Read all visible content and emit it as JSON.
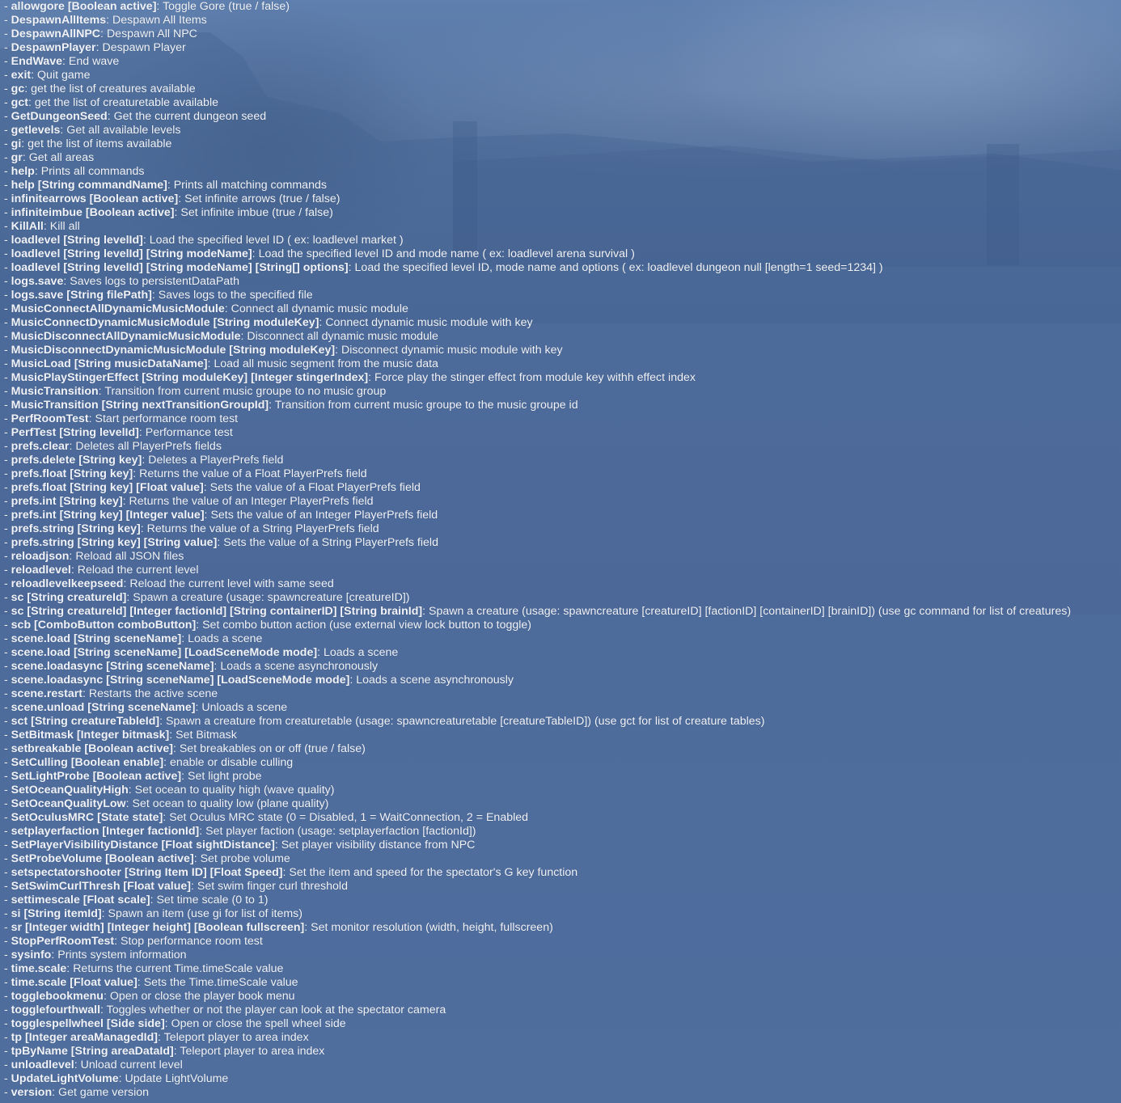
{
  "console": {
    "commands": [
      {
        "name": "allowgore [Boolean active]",
        "desc": "Toggle Gore (true / false)"
      },
      {
        "name": "DespawnAllItems",
        "desc": "Despawn All Items"
      },
      {
        "name": "DespawnAllNPC",
        "desc": "Despawn All NPC"
      },
      {
        "name": "DespawnPlayer",
        "desc": "Despawn Player"
      },
      {
        "name": "EndWave",
        "desc": "End wave"
      },
      {
        "name": "exit",
        "desc": "Quit game"
      },
      {
        "name": "gc",
        "desc": "get the list of creatures available"
      },
      {
        "name": "gct",
        "desc": "get the list of creaturetable available"
      },
      {
        "name": "GetDungeonSeed",
        "desc": "Get the current dungeon seed"
      },
      {
        "name": "getlevels",
        "desc": "Get all available levels"
      },
      {
        "name": "gi",
        "desc": "get the list of items available"
      },
      {
        "name": "gr",
        "desc": "Get all areas"
      },
      {
        "name": "help",
        "desc": "Prints all commands"
      },
      {
        "name": "help [String commandName]",
        "desc": "Prints all matching commands"
      },
      {
        "name": "infinitearrows [Boolean active]",
        "desc": "Set infinite arrows (true / false)"
      },
      {
        "name": "infiniteimbue [Boolean active]",
        "desc": "Set infinite imbue (true / false)"
      },
      {
        "name": "KillAll",
        "desc": "Kill all"
      },
      {
        "name": "loadlevel [String levelId]",
        "desc": "Load the specified level ID ( ex: loadlevel market )"
      },
      {
        "name": "loadlevel [String levelId] [String modeName]",
        "desc": "Load the specified level ID and mode name ( ex: loadlevel arena survival )"
      },
      {
        "name": "loadlevel [String levelId] [String modeName] [String[] options]",
        "desc": "Load the specified level ID, mode name and options ( ex: loadlevel dungeon null [length=1 seed=1234] )"
      },
      {
        "name": "logs.save",
        "desc": "Saves logs to persistentDataPath"
      },
      {
        "name": "logs.save [String filePath]",
        "desc": "Saves logs to the specified file"
      },
      {
        "name": "MusicConnectAllDynamicMusicModule",
        "desc": "Connect all dynamic music module"
      },
      {
        "name": "MusicConnectDynamicMusicModule [String moduleKey]",
        "desc": "Connect dynamic music module with key"
      },
      {
        "name": "MusicDisconnectAllDynamicMusicModule",
        "desc": "Disconnect all dynamic music module"
      },
      {
        "name": "MusicDisconnectDynamicMusicModule [String moduleKey]",
        "desc": "Disconnect dynamic music module with key"
      },
      {
        "name": "MusicLoad [String musicDataName]",
        "desc": "Load all music segment from the music data"
      },
      {
        "name": "MusicPlayStingerEffect [String moduleKey] [Integer stingerIndex]",
        "desc": "Force play the stinger effect from module key withh effect index"
      },
      {
        "name": "MusicTransition",
        "desc": "Transition from current music groupe to no music group"
      },
      {
        "name": "MusicTransition [String nextTransitionGroupId]",
        "desc": "Transition from current music groupe to the music groupe id"
      },
      {
        "name": "PerfRoomTest",
        "desc": "Start performance room test"
      },
      {
        "name": "PerfTest [String levelId]",
        "desc": "Performance test"
      },
      {
        "name": "prefs.clear",
        "desc": "Deletes all PlayerPrefs fields"
      },
      {
        "name": "prefs.delete [String key]",
        "desc": "Deletes a PlayerPrefs field"
      },
      {
        "name": "prefs.float [String key]",
        "desc": "Returns the value of a Float PlayerPrefs field"
      },
      {
        "name": "prefs.float [String key] [Float value]",
        "desc": "Sets the value of a Float PlayerPrefs field"
      },
      {
        "name": "prefs.int [String key]",
        "desc": "Returns the value of an Integer PlayerPrefs field"
      },
      {
        "name": "prefs.int [String key] [Integer value]",
        "desc": "Sets the value of an Integer PlayerPrefs field"
      },
      {
        "name": "prefs.string [String key]",
        "desc": "Returns the value of a String PlayerPrefs field"
      },
      {
        "name": "prefs.string [String key] [String value]",
        "desc": "Sets the value of a String PlayerPrefs field"
      },
      {
        "name": "reloadjson",
        "desc": "Reload all JSON files"
      },
      {
        "name": "reloadlevel",
        "desc": "Reload the current level"
      },
      {
        "name": "reloadlevelkeepseed",
        "desc": "Reload the current level with same seed"
      },
      {
        "name": "sc [String creatureId]",
        "desc": "Spawn a creature (usage: spawncreature [creatureID])"
      },
      {
        "name": "sc [String creatureId] [Integer factionId] [String containerID] [String brainId]",
        "desc": "Spawn a creature (usage: spawncreature [creatureID] [factionID] [containerID] [brainID]) (use gc command for list of creatures)"
      },
      {
        "name": "scb [ComboButton comboButton]",
        "desc": "Set combo button action (use external view lock button to toggle)"
      },
      {
        "name": "scene.load [String sceneName]",
        "desc": "Loads a scene"
      },
      {
        "name": "scene.load [String sceneName] [LoadSceneMode mode]",
        "desc": "Loads a scene"
      },
      {
        "name": "scene.loadasync [String sceneName]",
        "desc": "Loads a scene asynchronously"
      },
      {
        "name": "scene.loadasync [String sceneName] [LoadSceneMode mode]",
        "desc": "Loads a scene asynchronously"
      },
      {
        "name": "scene.restart",
        "desc": "Restarts the active scene"
      },
      {
        "name": "scene.unload [String sceneName]",
        "desc": "Unloads a scene"
      },
      {
        "name": "sct [String creatureTableId]",
        "desc": "Spawn a creature from creaturetable (usage: spawncreaturetable [creatureTableID]) (use gct for list of creature tables)"
      },
      {
        "name": "SetBitmask [Integer bitmask]",
        "desc": "Set Bitmask"
      },
      {
        "name": "setbreakable [Boolean active]",
        "desc": "Set breakables on or off (true / false)"
      },
      {
        "name": "SetCulling [Boolean enable]",
        "desc": "enable or disable culling"
      },
      {
        "name": "SetLightProbe [Boolean active]",
        "desc": "Set light probe"
      },
      {
        "name": "SetOceanQualityHigh",
        "desc": "Set ocean to quality high (wave quality)"
      },
      {
        "name": "SetOceanQualityLow",
        "desc": "Set ocean to quality low (plane quality)"
      },
      {
        "name": "SetOculusMRC [State state]",
        "desc": "Set Oculus MRC state (0 = Disabled, 1 = WaitConnection, 2 = Enabled"
      },
      {
        "name": "setplayerfaction [Integer factionId]",
        "desc": "Set player faction (usage: setplayerfaction [factionId])"
      },
      {
        "name": "SetPlayerVisibilityDistance [Float sightDistance]",
        "desc": "Set player visibility distance from NPC"
      },
      {
        "name": "SetProbeVolume [Boolean active]",
        "desc": "Set probe volume"
      },
      {
        "name": "setspectatorshooter [String Item ID] [Float Speed]",
        "desc": "Set the item and speed for the spectator's G key function"
      },
      {
        "name": "SetSwimCurlThresh [Float value]",
        "desc": "Set swim finger curl threshold"
      },
      {
        "name": "settimescale [Float scale]",
        "desc": "Set time scale (0 to 1)"
      },
      {
        "name": "si [String itemId]",
        "desc": "Spawn an item (use gi for list of items)"
      },
      {
        "name": "sr [Integer width] [Integer height] [Boolean fullscreen]",
        "desc": "Set monitor resolution (width, height, fullscreen)"
      },
      {
        "name": "StopPerfRoomTest",
        "desc": "Stop performance room test"
      },
      {
        "name": "sysinfo",
        "desc": "Prints system information"
      },
      {
        "name": "time.scale",
        "desc": "Returns the current Time.timeScale value"
      },
      {
        "name": "time.scale [Float value]",
        "desc": "Sets the Time.timeScale value"
      },
      {
        "name": "togglebookmenu",
        "desc": "Open or close the player book menu"
      },
      {
        "name": "togglefourthwall",
        "desc": "Toggles whether or not the player can look at the spectator camera"
      },
      {
        "name": "togglespellwheel [Side side]",
        "desc": "Open or close the spell wheel side"
      },
      {
        "name": "tp [Integer areaManagedId]",
        "desc": "Teleport player to area index"
      },
      {
        "name": "tpByName [String areaDataId]",
        "desc": "Teleport player to area index"
      },
      {
        "name": "unloadlevel",
        "desc": "Unload current level"
      },
      {
        "name": "UpdateLightVolume",
        "desc": "Update LightVolume"
      },
      {
        "name": "version",
        "desc": "Get game version"
      }
    ]
  }
}
